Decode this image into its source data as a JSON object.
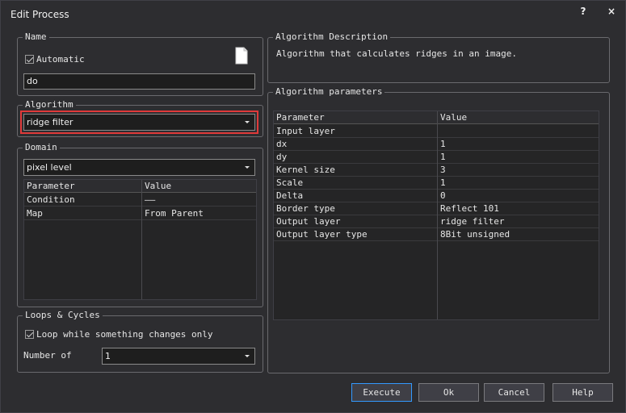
{
  "window": {
    "title": "Edit Process",
    "help_label": "?",
    "close_label": "×"
  },
  "name_group": {
    "legend": "Name",
    "automatic_label": "Automatic",
    "automatic_checked": true,
    "name_value": "do"
  },
  "algorithm_group": {
    "legend": "Algorithm",
    "selected": "ridge filter"
  },
  "domain_group": {
    "legend": "Domain",
    "selected": "pixel level",
    "headers": [
      "Parameter",
      "Value"
    ],
    "rows": [
      [
        "Condition",
        "——"
      ],
      [
        "Map",
        "From Parent"
      ]
    ]
  },
  "loops_group": {
    "legend": "Loops & Cycles",
    "loop_label": "Loop while something changes only",
    "loop_checked": true,
    "number_label": "Number of",
    "number_value": "1"
  },
  "description_group": {
    "legend": "Algorithm Description",
    "text": "Algorithm that calculates ridges in an image."
  },
  "parameters_group": {
    "legend": "Algorithm parameters",
    "headers": [
      "Parameter",
      "Value"
    ],
    "rows": [
      [
        "Input layer",
        ""
      ],
      [
        "dx",
        "1"
      ],
      [
        "dy",
        "1"
      ],
      [
        "Kernel size",
        "3"
      ],
      [
        "Scale",
        "1"
      ],
      [
        "Delta",
        "0"
      ],
      [
        "Border type",
        "Reflect 101"
      ],
      [
        "Output layer",
        "ridge filter"
      ],
      [
        "Output layer type",
        "8Bit unsigned"
      ]
    ]
  },
  "buttons": {
    "execute": "Execute",
    "ok": "Ok",
    "cancel": "Cancel",
    "help": "Help"
  },
  "colors": {
    "background": "#2d2d30",
    "highlight": "#e03a3a",
    "primary_border": "#3399ff"
  }
}
